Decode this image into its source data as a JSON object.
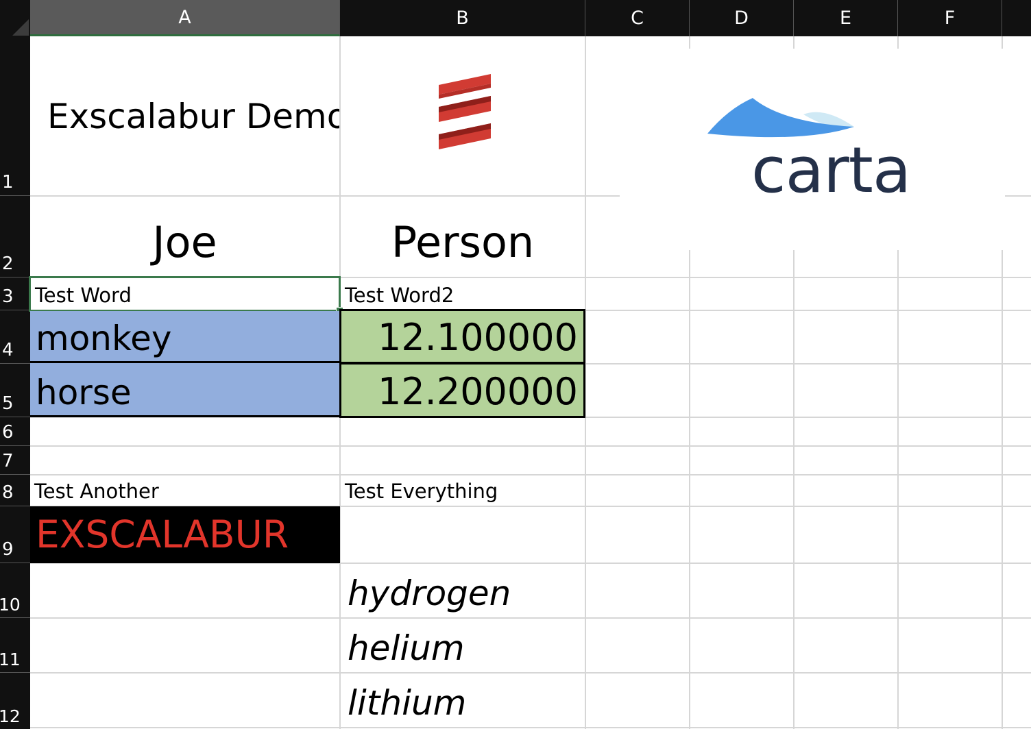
{
  "columns": [
    "A",
    "B",
    "C",
    "D",
    "E",
    "F"
  ],
  "rows": [
    "1",
    "2",
    "3",
    "4",
    "5",
    "6",
    "7",
    "8",
    "9",
    "10",
    "11",
    "12"
  ],
  "cells": {
    "A1": "Exscalabur Demo",
    "A2": "Joe",
    "B2": "Person",
    "A3": "Test Word",
    "B3": "Test Word2",
    "A4": "monkey",
    "B4": "12.100000",
    "A5": "horse",
    "B5": "12.200000",
    "A8": "Test Another",
    "B8": "Test Everything",
    "A9": "EXSCALABUR",
    "B10": "hydrogen",
    "B11": "helium",
    "B12": "lithium"
  },
  "images": {
    "scala_logo": "scala-logo",
    "carta_logo_text": "carta"
  },
  "colors": {
    "header_bg": "#111111",
    "selected_header_bg": "#5a5a5a",
    "selection_green": "#3b7a4c",
    "fill_blue": "#92aedd",
    "fill_green": "#b4d39a",
    "fill_black": "#000000",
    "red_text": "#e2352b",
    "scala_red": "#d13b33",
    "carta_blue": "#4a97e6",
    "carta_light": "#cfe9f5",
    "carta_navy": "#243049"
  }
}
